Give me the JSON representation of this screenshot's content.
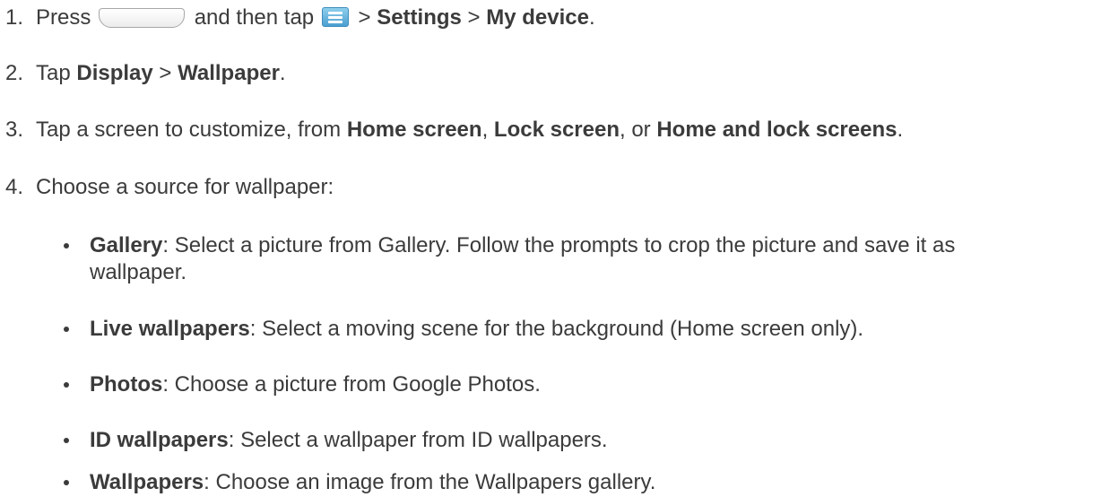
{
  "steps": [
    {
      "num": "1.",
      "t1": "Press",
      "t2": "and then tap",
      "sep1": ">",
      "b1": "Settings",
      "sep2": ">",
      "b2": "My device",
      "end": "."
    },
    {
      "num": "2.",
      "t1": "Tap",
      "b1": "Display",
      "sep1": ">",
      "b2": "Wallpaper",
      "end": "."
    },
    {
      "num": "3.",
      "t1": "Tap a screen to customize, from",
      "b1": "Home screen",
      "sep1": ",",
      "b2": "Lock screen",
      "sep2": ", or",
      "b3": "Home and lock screens",
      "end": "."
    },
    {
      "num": "4.",
      "t1": "Choose a source for wallpaper:"
    }
  ],
  "sources": [
    {
      "name": "Gallery",
      "desc_line1": ": Select a picture from Gallery. Follow the prompts to crop the picture and save it as",
      "desc_line2": "wallpaper."
    },
    {
      "name": "Live wallpapers",
      "desc": ": Select a moving scene for the background (Home screen only)."
    },
    {
      "name": "Photos",
      "desc": ": Choose a picture from Google Photos."
    },
    {
      "name": "ID wallpapers",
      "desc": ": Select a wallpaper from ID wallpapers."
    },
    {
      "name": "Wallpapers",
      "desc": ": Choose an image from the Wallpapers gallery."
    }
  ],
  "icons": {
    "home_key": "home-key-icon",
    "menu_key": "menu-icon"
  }
}
